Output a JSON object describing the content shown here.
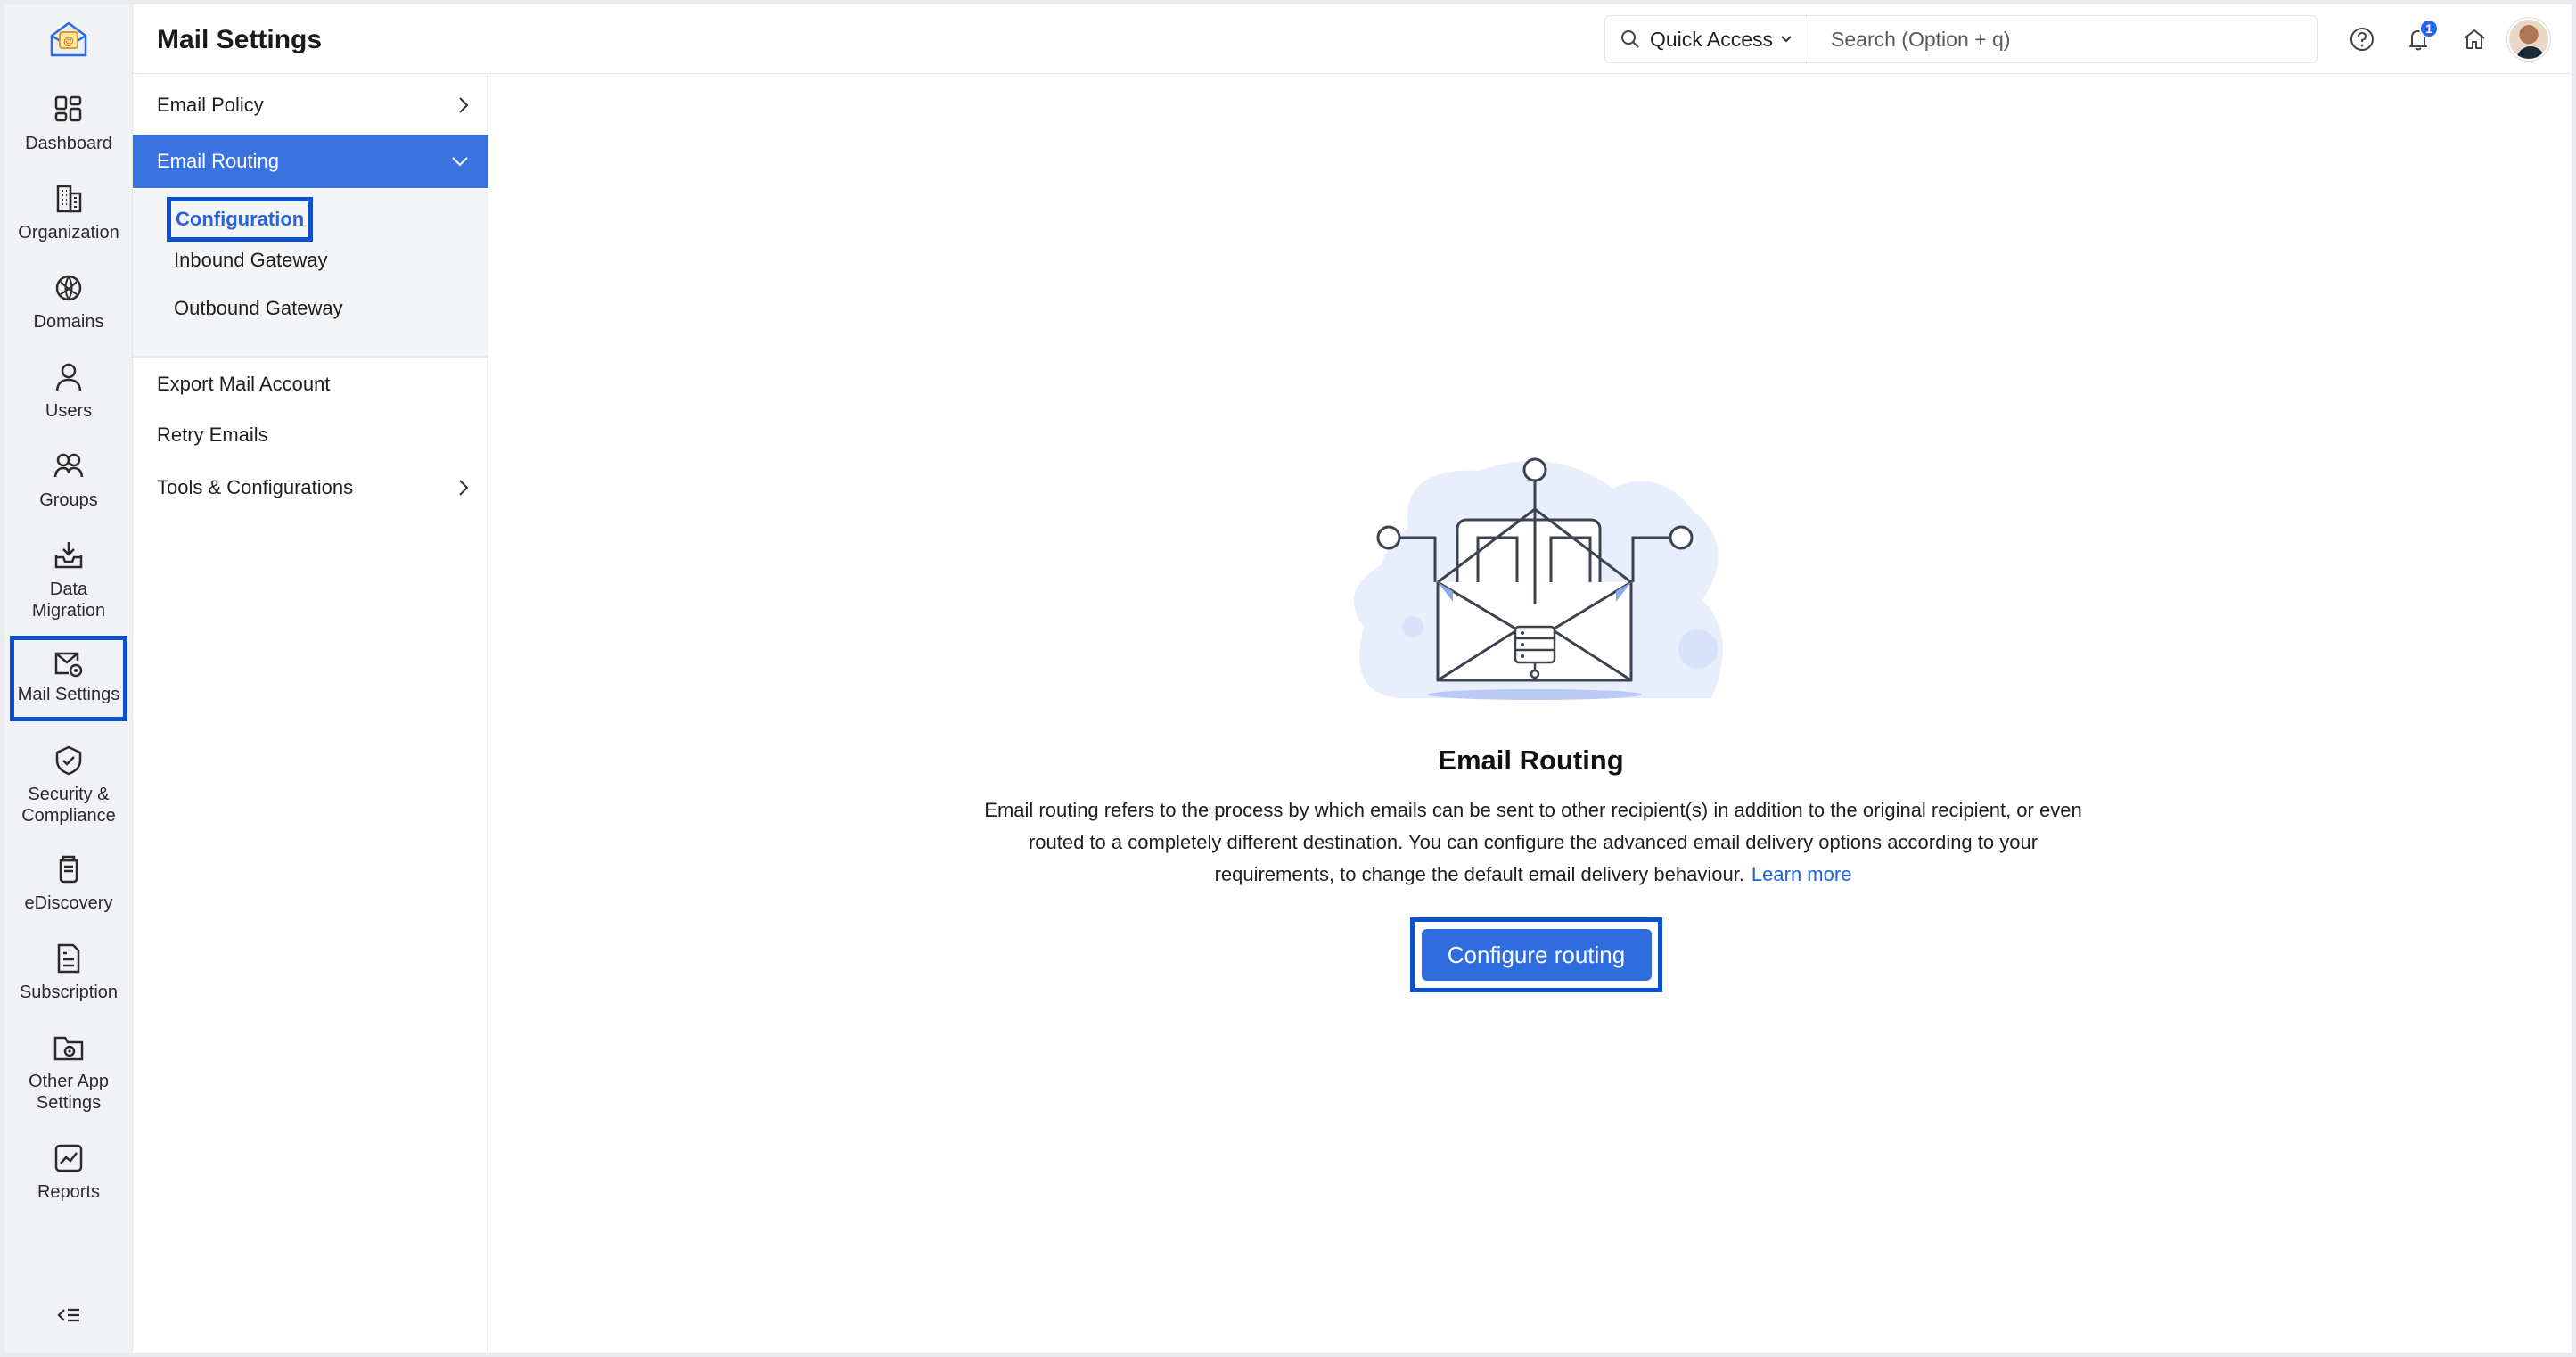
{
  "header": {
    "title": "Mail Settings",
    "quick_access_label": "Quick Access",
    "search_placeholder": "Search (Option + q)",
    "notification_count": "1"
  },
  "rail": {
    "items": [
      {
        "label": "Dashboard",
        "icon": "dashboard-icon"
      },
      {
        "label": "Organization",
        "icon": "organization-icon"
      },
      {
        "label": "Domains",
        "icon": "globe-icon"
      },
      {
        "label": "Users",
        "icon": "user-icon"
      },
      {
        "label": "Groups",
        "icon": "groups-icon"
      },
      {
        "label": "Data Migration",
        "icon": "data-migration-icon"
      },
      {
        "label": "Mail Settings",
        "icon": "mail-settings-icon"
      },
      {
        "label": "Security & Compliance",
        "icon": "shield-icon"
      },
      {
        "label": "eDiscovery",
        "icon": "ediscovery-icon"
      },
      {
        "label": "Subscription",
        "icon": "subscription-icon"
      },
      {
        "label": "Other App Settings",
        "icon": "other-app-settings-icon"
      },
      {
        "label": "Reports",
        "icon": "reports-icon"
      }
    ],
    "active": "Mail Settings"
  },
  "subnav": {
    "items": [
      {
        "label": "Email Policy"
      },
      {
        "label": "Email Routing"
      },
      {
        "label": "Export Mail Account"
      },
      {
        "label": "Retry Emails"
      },
      {
        "label": "Tools & Configurations"
      }
    ],
    "routing_children": [
      {
        "label": "Configuration"
      },
      {
        "label": "Inbound Gateway"
      },
      {
        "label": "Outbound Gateway"
      }
    ]
  },
  "main": {
    "heading": "Email Routing",
    "description": "Email routing refers to the process by which emails can be sent to other recipient(s) in addition to the original recipient, or even routed to a completely different destination. You can configure the advanced email delivery options according to your requirements, to change the default email delivery behaviour.",
    "learn_more": "Learn more",
    "cta_label": "Configure routing"
  },
  "colors": {
    "accent": "#3a72de",
    "highlight_box": "#0b50cc",
    "link": "#1f61d6"
  }
}
